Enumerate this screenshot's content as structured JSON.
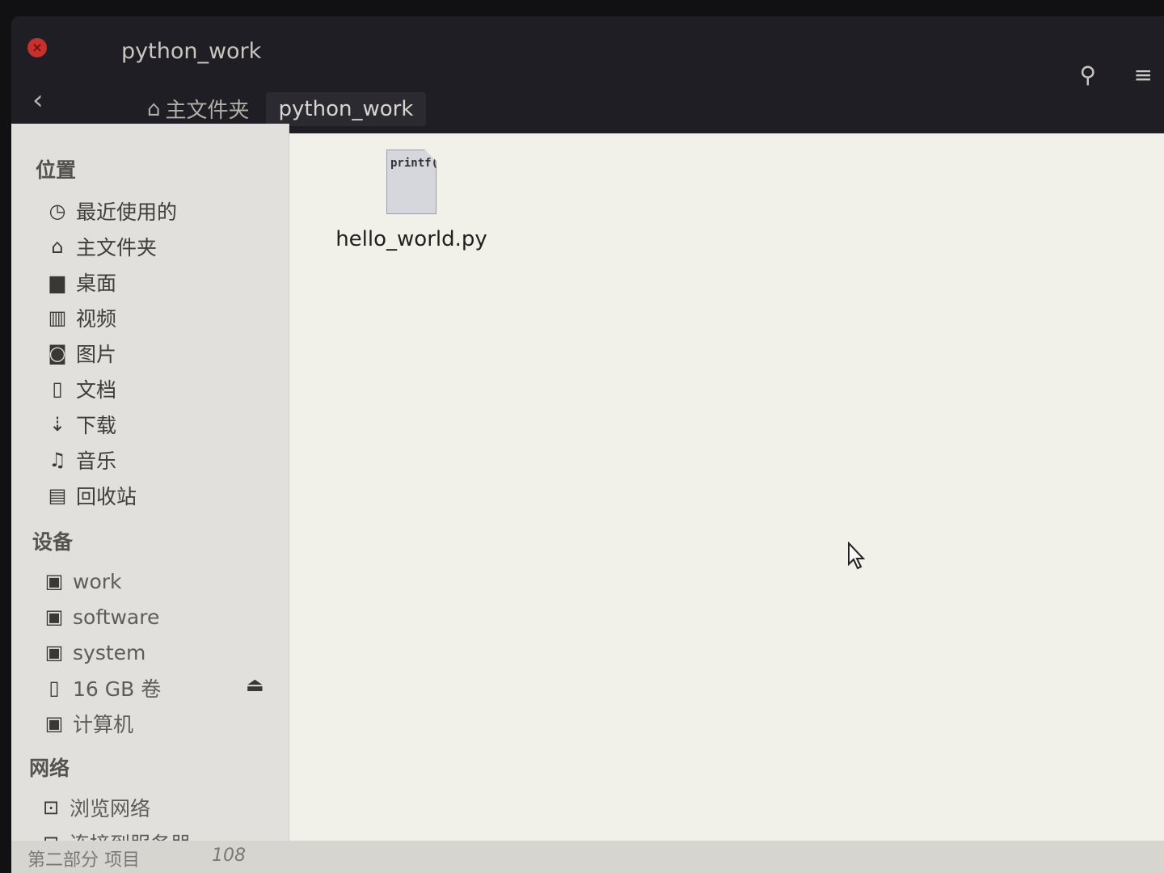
{
  "window": {
    "title": "python_work",
    "close_glyph": "×"
  },
  "toolbar": {
    "back_glyph": "‹",
    "breadcrumb_home": "主文件夹",
    "breadcrumb_current": "python_work",
    "search_glyph": "⚲",
    "menu_glyph": "≡"
  },
  "sidebar": {
    "places_header": "位置",
    "places": [
      {
        "icon": "clock-icon",
        "glyph": "◷",
        "label": "最近使用的"
      },
      {
        "icon": "home-icon",
        "glyph": "⌂",
        "label": "主文件夹"
      },
      {
        "icon": "folder-icon",
        "glyph": "▆",
        "label": "桌面"
      },
      {
        "icon": "film-icon",
        "glyph": "▥",
        "label": "视频"
      },
      {
        "icon": "camera-icon",
        "glyph": "◙",
        "label": "图片"
      },
      {
        "icon": "document-icon",
        "glyph": "▯",
        "label": "文档"
      },
      {
        "icon": "download-icon",
        "glyph": "⇣",
        "label": "下载"
      },
      {
        "icon": "music-icon",
        "glyph": "♫",
        "label": "音乐"
      },
      {
        "icon": "trash-icon",
        "glyph": "▤",
        "label": "回收站"
      }
    ],
    "devices_header": "设备",
    "devices": [
      {
        "icon": "drive-icon",
        "glyph": "▣",
        "label": "work"
      },
      {
        "icon": "drive-icon",
        "glyph": "▣",
        "label": "software"
      },
      {
        "icon": "drive-icon",
        "glyph": "▣",
        "label": "system"
      },
      {
        "icon": "usb-drive-icon",
        "glyph": "▯",
        "label": "16 GB 卷"
      },
      {
        "icon": "computer-icon",
        "glyph": "▣",
        "label": "计算机"
      }
    ],
    "eject_glyph": "⏏",
    "network_header": "网络",
    "network": [
      {
        "icon": "network-icon",
        "glyph": "⊡",
        "label": "浏览网络"
      },
      {
        "icon": "server-icon",
        "glyph": "⊟",
        "label": "连接到服务器"
      }
    ]
  },
  "content": {
    "files": [
      {
        "name": "hello_world.py",
        "preview": "printf("
      }
    ]
  },
  "statusbar": {
    "left_text": "第二部分    项目",
    "number": "108"
  }
}
